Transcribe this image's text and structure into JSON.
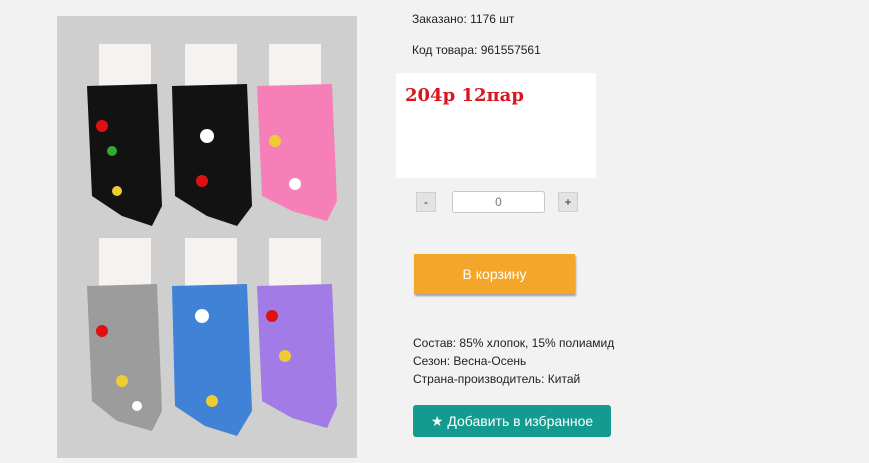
{
  "product": {
    "ordered_text": "Заказано: 1176 шт",
    "code_text": "Код товара: 961557561",
    "price_text": "204р 12пар",
    "qty_minus": "-",
    "qty_plus": "+",
    "qty_placeholder": "0",
    "cart_button": "В корзину",
    "spec_composition": "Состав: 85% хлопок, 15% полиамид",
    "spec_season": "Сезон: Весна-Осень",
    "spec_country": "Страна-производитель: Китай",
    "favorite_button": "Добавить в избранное",
    "favorite_icon": "star-icon"
  },
  "image": {
    "sock_colors": [
      "#121212",
      "#121212",
      "#f77fb8",
      "#9c9c9c",
      "#3f82d6",
      "#a27be6"
    ],
    "accent": "#d8161f"
  }
}
